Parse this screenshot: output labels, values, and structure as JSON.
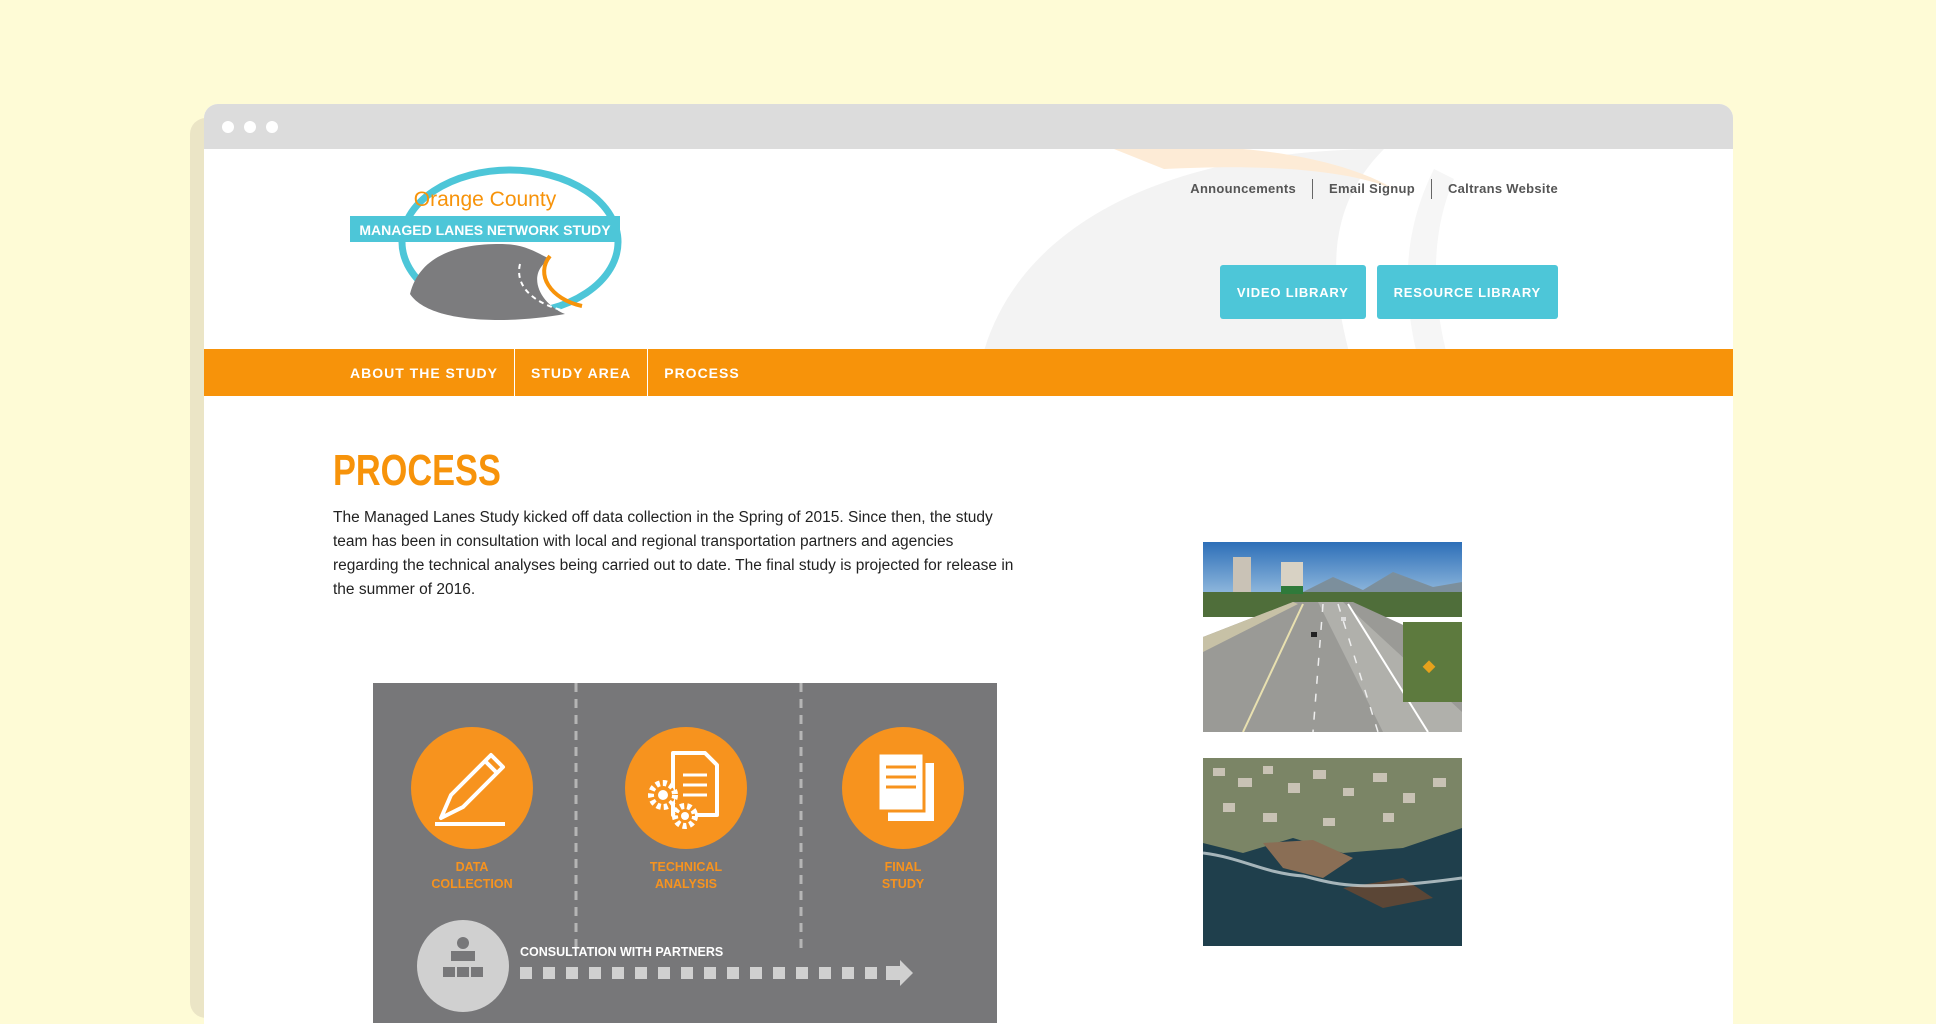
{
  "logo": {
    "line1": "Orange County",
    "line2": "MANAGED LANES NETWORK STUDY"
  },
  "top_links": [
    "Announcements",
    "Email Signup",
    "Caltrans Website"
  ],
  "buttons": {
    "video_library": "VIDEO LIBRARY",
    "resource_library": "RESOURCE LIBRARY"
  },
  "nav": [
    "ABOUT THE STUDY",
    "STUDY AREA",
    "PROCESS"
  ],
  "page": {
    "title": "PROCESS",
    "intro": "The Managed Lanes Study kicked off data collection in the Spring of 2015. Since then, the study team has been in consultation with local and regional transportation partners and agencies regarding the technical analyses being carried out to date. The final study is projected for release in the summer of 2016."
  },
  "infographic": {
    "steps": [
      {
        "line1": "DATA",
        "line2": "COLLECTION",
        "icon": "pencil-icon"
      },
      {
        "line1": "TECHNICAL",
        "line2": "ANALYSIS",
        "icon": "gears-document-icon"
      },
      {
        "line1": "FINAL",
        "line2": "STUDY",
        "icon": "documents-icon"
      }
    ],
    "consultation": "CONSULTATION WITH PARTNERS"
  },
  "colors": {
    "accent": "#f7930a",
    "teal": "#4dc6d8",
    "infographic_bg": "#777779",
    "background": "#fefbd6"
  }
}
